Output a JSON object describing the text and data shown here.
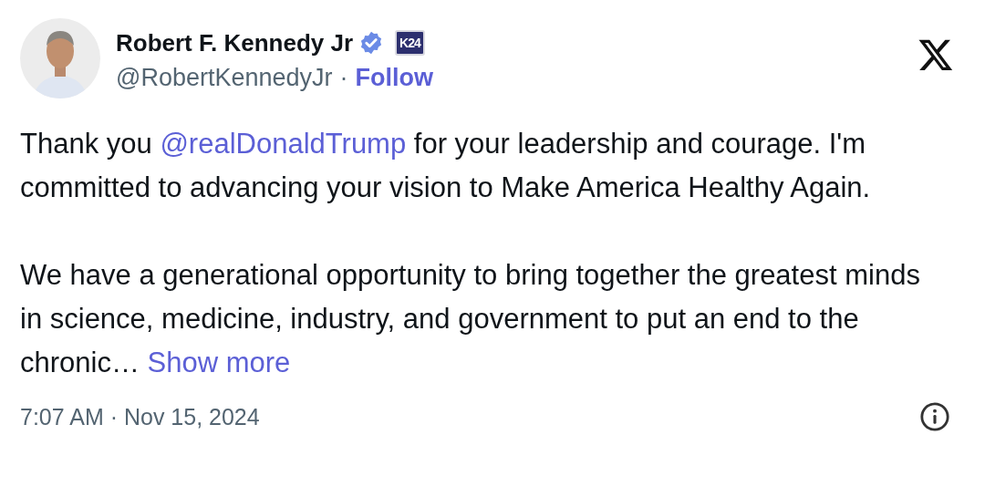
{
  "author": {
    "name": "Robert F. Kennedy Jr",
    "verified": true,
    "badge": "K24",
    "handle": "@RobertKennedyJr",
    "separator": "·",
    "follow": "Follow"
  },
  "paragraphs": [
    {
      "segments": [
        {
          "kind": "text",
          "text": "Thank you "
        },
        {
          "kind": "mention",
          "text": "@realDonaldTrump"
        },
        {
          "kind": "text",
          "text": " for your leadership and courage. I'm committed to advancing your vision to Make America Healthy Again."
        }
      ]
    },
    {
      "segments": [
        {
          "kind": "text",
          "text": "We have a generational opportunity to bring together the greatest minds in science, medicine, industry, and government to put an end to the chronic… "
        },
        {
          "kind": "more",
          "text": "Show more"
        }
      ]
    }
  ],
  "timestamp": "7:07 AM · Nov 15, 2024"
}
